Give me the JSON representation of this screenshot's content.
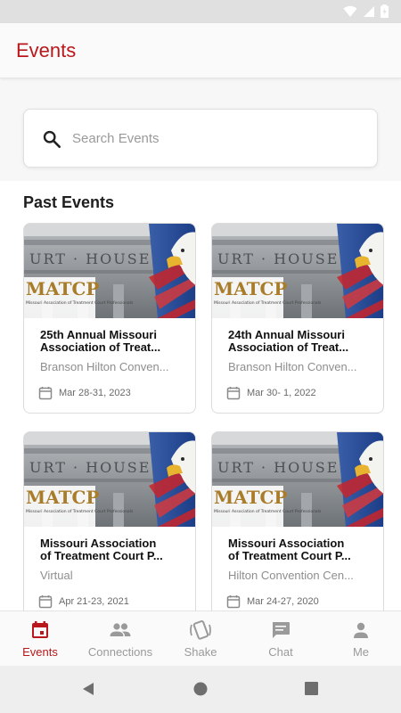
{
  "app": {
    "title": "Events"
  },
  "search": {
    "placeholder": "Search Events"
  },
  "past_events": {
    "title": "Past Events",
    "cards": [
      {
        "title_line1": "25th Annual Missouri",
        "title_line2": "Association of Treat...",
        "location": "Branson Hilton Conven...",
        "date": "Mar 28-31, 2023",
        "logo_text": "MATCP",
        "logo_subtext": "Missouri Association of Treatment Court Professionals",
        "building_text": "URT · HOUSE"
      },
      {
        "title_line1": "24th Annual Missouri",
        "title_line2": "Association of Treat...",
        "location": "Branson Hilton Conven...",
        "date": "Mar 30- 1, 2022",
        "logo_text": "MATCP",
        "logo_subtext": "Missouri Association of Treatment Court Professionals",
        "building_text": "URT · HOUSE"
      },
      {
        "title_line1": "Missouri Association",
        "title_line2": "of Treatment Court P...",
        "location": "Virtual",
        "date": "Apr 21-23, 2021",
        "logo_text": "MATCP",
        "logo_subtext": "Missouri Association of Treatment Court Professionals",
        "building_text": "URT · HOUSE"
      },
      {
        "title_line1": "Missouri Association",
        "title_line2": "of Treatment Court P...",
        "location": "Hilton Convention Cen...",
        "date": "Mar 24-27, 2020",
        "logo_text": "MATCP",
        "logo_subtext": "Missouri Association of Treatment Court Professionals",
        "building_text": "URT · HOUSE"
      }
    ]
  },
  "bottom_nav": {
    "items": [
      {
        "label": "Events",
        "icon": "calendar-icon",
        "active": true
      },
      {
        "label": "Connections",
        "icon": "people-icon",
        "active": false
      },
      {
        "label": "Shake",
        "icon": "shake-icon",
        "active": false
      },
      {
        "label": "Chat",
        "icon": "chat-icon",
        "active": false
      },
      {
        "label": "Me",
        "icon": "person-icon",
        "active": false
      }
    ]
  },
  "colors": {
    "accent": "#b8181b",
    "inactive": "#9a9a9a"
  }
}
